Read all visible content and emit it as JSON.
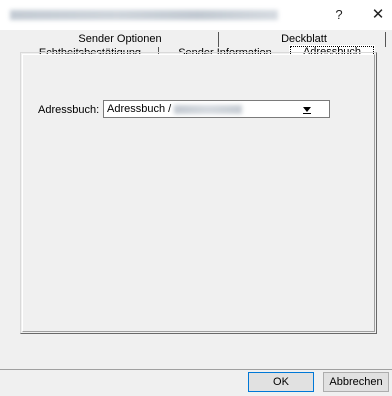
{
  "window": {
    "title": "",
    "help_label": "?",
    "close_label": "✕"
  },
  "tabs": {
    "row_back": [
      "Sender Optionen",
      "Deckblatt"
    ],
    "row_front": [
      "Echtheitsbestätigung",
      "Sender Information",
      "Adressbuch"
    ],
    "active": "Adressbuch"
  },
  "addressbook": {
    "label": "Adressbuch:",
    "value": "Adressbuch /"
  },
  "footer": {
    "ok_label": "OK",
    "cancel_label": "Abbrechen"
  }
}
